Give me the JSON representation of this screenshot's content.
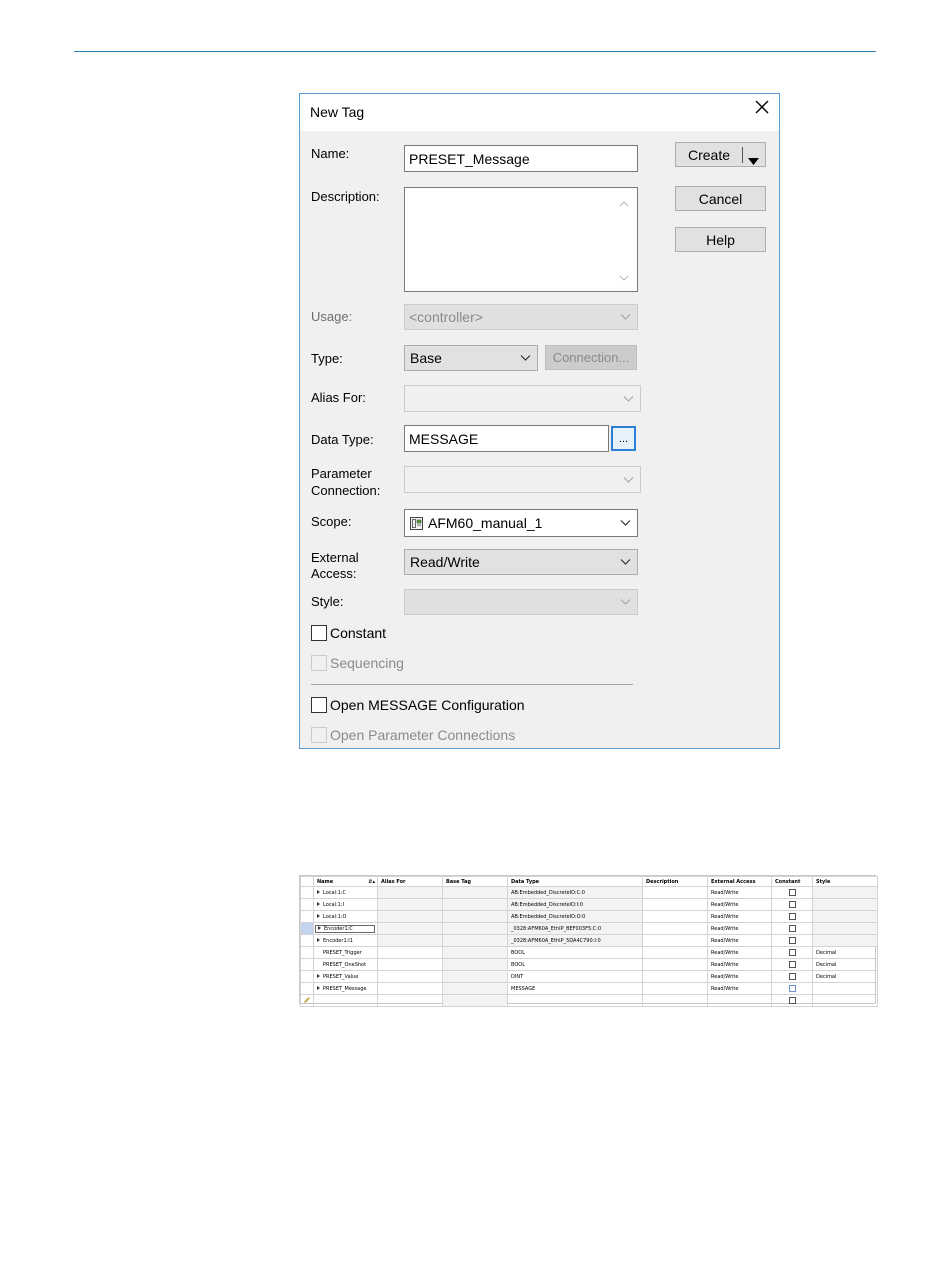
{
  "dialog": {
    "title": "New Tag",
    "name_label": "Name:",
    "name_value": "PRESET_Message",
    "description_label": "Description:",
    "description_value": "",
    "usage_label": "Usage:",
    "usage_value": "<controller>",
    "type_label": "Type:",
    "type_value": "Base",
    "connection_label": "Connection...",
    "alias_label": "Alias For:",
    "alias_value": "",
    "data_type_label": "Data Type:",
    "data_type_value": "MESSAGE",
    "browse_label": "...",
    "param_label_1": "Parameter",
    "param_label_2": "Connection:",
    "param_value": "",
    "scope_label": "Scope:",
    "scope_value": "AFM60_manual_1",
    "external_label_1": "External",
    "external_label_2": "Access:",
    "external_value": "Read/Write",
    "style_label": "Style:",
    "style_value": "",
    "constant_label": "Constant",
    "sequencing_label": "Sequencing",
    "open_config_label": "Open MESSAGE Configuration",
    "open_param_label": "Open Parameter Connections",
    "create_label": "Create",
    "cancel_label": "Cancel",
    "help_label": "Help"
  },
  "grid": {
    "headers": [
      "Name",
      "Alias For",
      "Base Tag",
      "Data Type",
      "Description",
      "External Access",
      "Constant",
      "Style"
    ],
    "rows": [
      {
        "name": "Local:1:C",
        "expand": true,
        "data_type": "AB:Embedded_DiscreteIO:C:0",
        "access": "Read/Write",
        "style": "",
        "shaded": true
      },
      {
        "name": "Local:1:I",
        "expand": true,
        "data_type": "AB:Embedded_DiscreteIO:I:0",
        "access": "Read/Write",
        "style": "",
        "shaded": true
      },
      {
        "name": "Local:1:O",
        "expand": true,
        "data_type": "AB:Embedded_DiscreteIO:O:0",
        "access": "Read/Write",
        "style": "",
        "shaded": true
      },
      {
        "name": "Encoder1:C",
        "expand": true,
        "data_type": "_0328:AFM60A_EthIP_BEF003F5:C:0",
        "access": "Read/Write",
        "style": "",
        "shaded": true
      },
      {
        "name": "Encoder1:I1",
        "expand": true,
        "data_type": "_0328:AFM60A_EthIP_5DA4C790:I:0",
        "access": "Read/Write",
        "style": "",
        "shaded": true
      },
      {
        "name": "PRESET_Trigger",
        "expand": false,
        "data_type": "BOOL",
        "access": "Read/Write",
        "style": "Decimal",
        "shaded": false
      },
      {
        "name": "PRESET_OneShot",
        "expand": false,
        "data_type": "BOOL",
        "access": "Read/Write",
        "style": "Decimal",
        "shaded": false
      },
      {
        "name": "PRESET_Value",
        "expand": true,
        "data_type": "DINT",
        "access": "Read/Write",
        "style": "Decimal",
        "shaded": false
      },
      {
        "name": "PRESET_Message",
        "expand": true,
        "data_type": "MESSAGE",
        "access": "Read/Write",
        "style": "",
        "shaded": false
      }
    ]
  }
}
